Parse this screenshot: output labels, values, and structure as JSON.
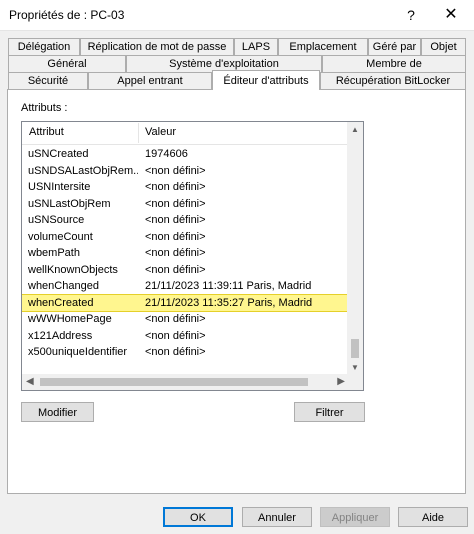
{
  "window": {
    "title": "Propriétés de : PC-03",
    "help_glyph": "?",
    "close_glyph": "✕"
  },
  "tabs": {
    "row1": [
      "Délégation",
      "Réplication de mot de passe",
      "LAPS",
      "Emplacement",
      "Géré par",
      "Objet"
    ],
    "row2": [
      "Général",
      "Système d'exploitation",
      "Membre de"
    ],
    "row3": [
      "Sécurité",
      "Appel entrant",
      "Éditeur d'attributs",
      "Récupération BitLocker"
    ],
    "active": "Éditeur d'attributs"
  },
  "panel": {
    "attributes_label": "Attributs :",
    "columns": {
      "attribute": "Attribut",
      "value": "Valeur"
    },
    "rows": [
      {
        "attr": "uSNCreated",
        "value": "1974606"
      },
      {
        "attr": "uSNDSALastObjRem...",
        "value": "<non défini>"
      },
      {
        "attr": "USNIntersite",
        "value": "<non défini>"
      },
      {
        "attr": "uSNLastObjRem",
        "value": "<non défini>"
      },
      {
        "attr": "uSNSource",
        "value": "<non défini>"
      },
      {
        "attr": "volumeCount",
        "value": "<non défini>"
      },
      {
        "attr": "wbemPath",
        "value": "<non défini>"
      },
      {
        "attr": "wellKnownObjects",
        "value": "<non défini>"
      },
      {
        "attr": "whenChanged",
        "value": "21/11/2023 11:39:11 Paris, Madrid"
      },
      {
        "attr": "whenCreated",
        "value": "21/11/2023 11:35:27 Paris, Madrid"
      },
      {
        "attr": "wWWHomePage",
        "value": "<non défini>"
      },
      {
        "attr": "x121Address",
        "value": "<non défini>"
      },
      {
        "attr": "x500uniqueIdentifier",
        "value": "<non défini>"
      }
    ],
    "highlighted_attr": "whenCreated",
    "modify_label": "Modifier",
    "filter_label": "Filtrer"
  },
  "footer": {
    "ok_label": "OK",
    "cancel_label": "Annuler",
    "apply_label": "Appliquer",
    "help_label": "Aide"
  },
  "colors": {
    "highlight": "#fff68f",
    "default_button_border": "#0078d7"
  },
  "icons": {
    "scroll_up": "▲",
    "scroll_down": "▼",
    "scroll_left": "◀",
    "scroll_right": "▶"
  }
}
